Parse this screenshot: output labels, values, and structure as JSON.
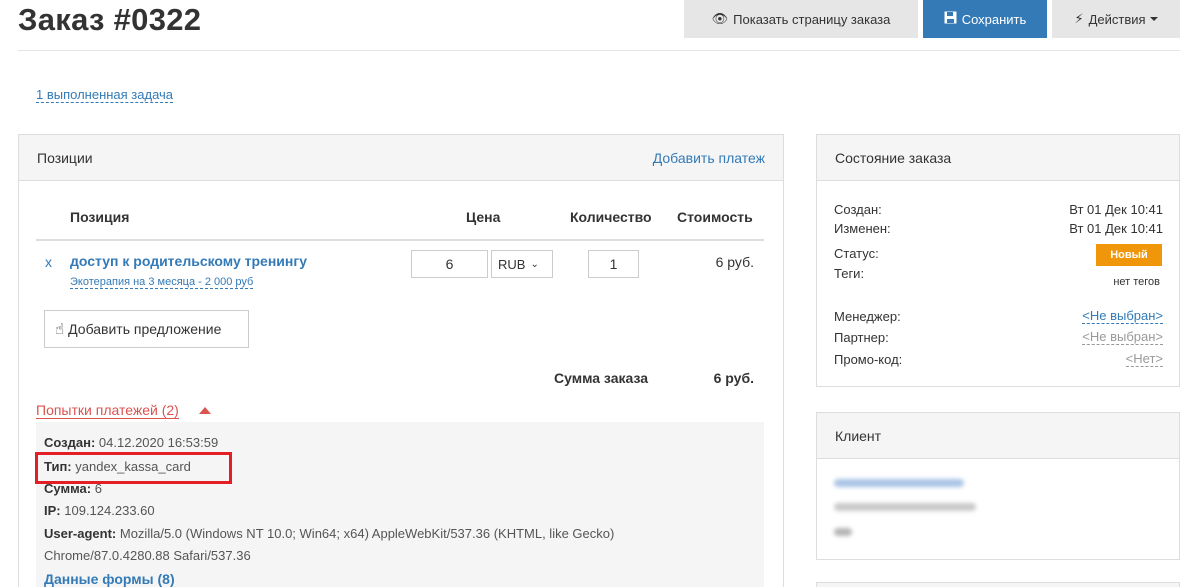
{
  "header": {
    "title": "Заказ #0322",
    "view_order_label": "Показать страницу заказа",
    "save_label": "Сохранить",
    "actions_label": "Действия"
  },
  "tasks_link": "1 выполненная задача",
  "positions": {
    "panel_title": "Позиции",
    "add_payment": "Добавить платеж",
    "columns": {
      "position": "Позиция",
      "price": "Цена",
      "quantity": "Количество",
      "cost": "Стоимость"
    },
    "items": [
      {
        "remove": "x",
        "name": "доступ к родительскому тренингу",
        "offer": "Экотерапия на 3 месяца - 2 000 руб",
        "price": "6",
        "currency": "RUB",
        "quantity": "1",
        "cost": "6 руб."
      }
    ],
    "add_offer": "Добавить предложение",
    "sum_label": "Сумма заказа",
    "sum_value": "6 руб."
  },
  "payment_attempts": {
    "toggle_label": "Попытки платежей (2)",
    "created_label": "Создан:",
    "created_value": "04.12.2020 16:53:59",
    "type_label": "Тип:",
    "type_value": "yandex_kassa_card",
    "amount_label": "Сумма:",
    "amount_value": "6",
    "ip_label": "IP:",
    "ip_value": "109.124.233.60",
    "ua_label": "User-agent:",
    "ua_line1": "Mozilla/5.0 (Windows NT 10.0; Win64; x64) AppleWebKit/537.36 (KHTML, like Gecko)",
    "ua_line2": "Chrome/87.0.4280.88 Safari/537.36",
    "form_data": "Данные формы (8)"
  },
  "order_state": {
    "panel_title": "Состояние заказа",
    "created_label": "Создан:",
    "created_value": "Вт 01 Дек 10:41",
    "changed_label": "Изменен:",
    "changed_value": "Вт 01 Дек 10:41",
    "status_label": "Статус:",
    "status_value": "Новый",
    "tags_label": "Теги:",
    "tags_value": "нет тегов",
    "manager_label": "Менеджер:",
    "manager_value": "<Не выбран>",
    "partner_label": "Партнер:",
    "partner_value": "<Не выбран>",
    "promo_label": "Промо-код:",
    "promo_value": "<Нет>"
  },
  "client": {
    "panel_title": "Клиент"
  },
  "colors": {
    "primary": "#337ab7",
    "danger": "#d9534f",
    "status_new": "#f0960a",
    "highlight_box": "#e31e24"
  }
}
